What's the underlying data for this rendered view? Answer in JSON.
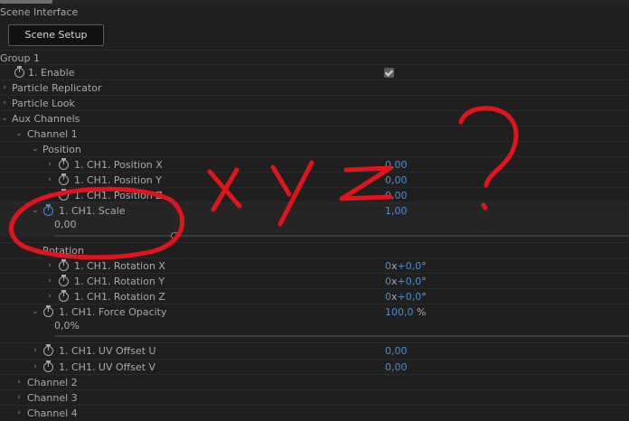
{
  "panel": {
    "scene_interface": "Scene Interface",
    "scene_setup_button": "Scene Setup",
    "group_label": "Group 1"
  },
  "rows": {
    "enable": "1. Enable",
    "particle_replicator": "Particle Replicator",
    "particle_look": "Particle Look",
    "aux_channels": "Aux Channels",
    "channel1": "Channel 1",
    "position": "Position",
    "pos_x": {
      "label": "1. CH1. Position X",
      "value": "0,00"
    },
    "pos_y": {
      "label": "1. CH1. Position Y",
      "value": "0,00"
    },
    "pos_z": {
      "label": "1. CH1. Position Z",
      "value": "0,00"
    },
    "scale": {
      "label": "1. CH1. Scale",
      "value": "1,00",
      "slider_value": "0,00"
    },
    "rotation": "Rotation",
    "rot_x": {
      "label": "1. CH1. Rotation X",
      "value": "0",
      "x": "x",
      "value2": "+0,0",
      "unit": "°"
    },
    "rot_y": {
      "label": "1. CH1. Rotation Y",
      "value": "0",
      "x": "x",
      "value2": "+0,0",
      "unit": "°"
    },
    "rot_z": {
      "label": "1. CH1. Rotation Z",
      "value": "0",
      "x": "x",
      "value2": "+0,0",
      "unit": "°"
    },
    "force_opacity": {
      "label": "1. CH1. Force Opacity",
      "value": "100,0",
      "unit": "%",
      "slider_value": "0,0%"
    },
    "uv_u": {
      "label": "1. CH1. UV Offset U",
      "value": "0,00"
    },
    "uv_v": {
      "label": "1. CH1. UV Offset V",
      "value": "0,00"
    },
    "channel2": "Channel 2",
    "channel3": "Channel 3",
    "channel4": "Channel 4"
  },
  "colors": {
    "background": "#1f1f1f",
    "text": "#a9a9a9",
    "value_blue": "#4a8dd9",
    "annotation_red": "#e0151c"
  }
}
